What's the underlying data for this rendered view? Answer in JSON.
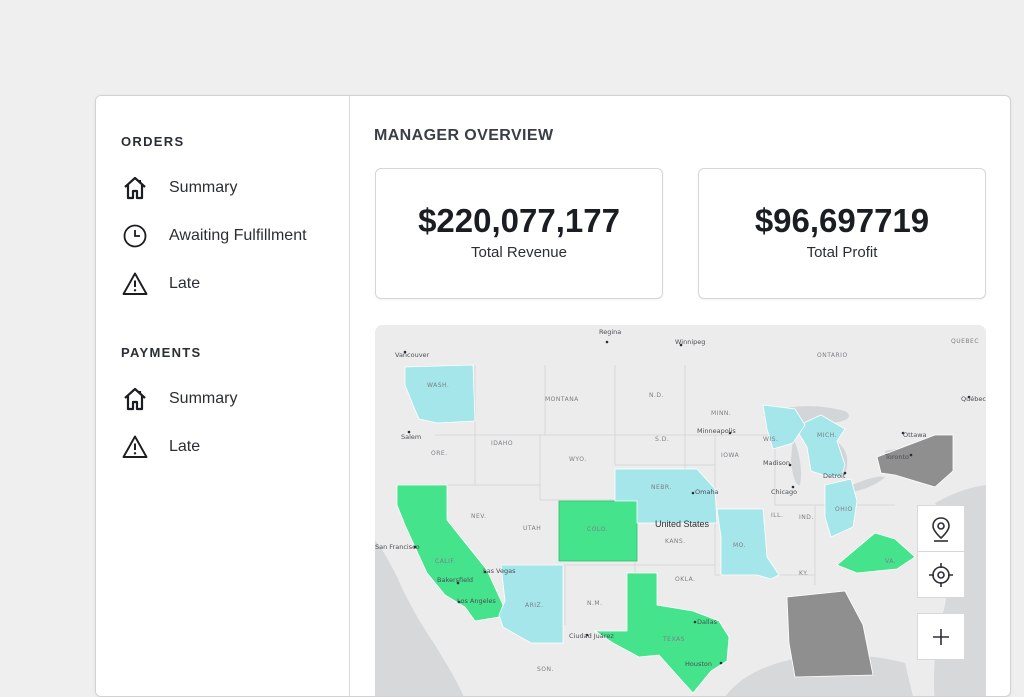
{
  "sidebar": {
    "orders_title": "ORDERS",
    "orders_items": [
      {
        "label": "Summary",
        "icon": "home-icon"
      },
      {
        "label": "Awaiting Fulfillment",
        "icon": "clock-icon"
      },
      {
        "label": "Late",
        "icon": "warning-icon"
      }
    ],
    "payments_title": "PAYMENTS",
    "payments_items": [
      {
        "label": "Summary",
        "icon": "home-icon"
      },
      {
        "label": "Late",
        "icon": "warning-icon"
      }
    ]
  },
  "main": {
    "title": "MANAGER OVERVIEW",
    "kpis": [
      {
        "value": "$220,077,177",
        "label": "Total Revenue"
      },
      {
        "value": "$96,697719",
        "label": "Total Profit"
      }
    ]
  },
  "map": {
    "country": "United States",
    "state_abbrevs": {
      "mont": "MONTANA",
      "nd": "N.D.",
      "minn": "MINN.",
      "ore": "ORE.",
      "idaho": "IDAHO",
      "wyo": "WYO.",
      "sd": "S.D.",
      "iowa": "IOWA",
      "wis": "WIS.",
      "mich": "MICH.",
      "nev": "NEV.",
      "utah": "UTAH",
      "colo": "COLO.",
      "nebr": "NEBR.",
      "kans": "KANS.",
      "mo": "MO.",
      "ill": "ILL.",
      "ind": "IND.",
      "ohio": "OHIO",
      "calif": "CALIF.",
      "ariz": "ARIZ.",
      "nm": "N.M.",
      "okla": "OKLA.",
      "tex": "TEXAS",
      "ky": "KY.",
      "va": "VA.",
      "wash": "WASH."
    },
    "cities": {
      "vancouver": "Vancouver",
      "salem": "Salem",
      "regina": "Regina",
      "winnipeg": "Winnipeg",
      "ontario": "ONTARIO",
      "quebec": "QUEBEC",
      "quebec_city": "Québec",
      "ottawa": "Ottawa",
      "toronto": "Toronto",
      "minneapolis": "Minneapolis",
      "madison": "Madison",
      "chicago": "Chicago",
      "detroit": "Detroit",
      "omaha": "Omaha",
      "san_francisco": "San Francisco",
      "bakersfield": "Bakersfield",
      "las_vegas": "Las Vegas",
      "los_angeles": "Los Angeles",
      "ciudad_juarez": "Ciudad Juárez",
      "dallas": "Dallas",
      "houston": "Houston",
      "son": "SON."
    },
    "legend_colors": {
      "high": "#45e38c",
      "medium": "#a4e6ea",
      "low": "#8f8f8f",
      "none": "#e6e6e6"
    }
  },
  "map_controls": {
    "location_pin": "location-pin-icon",
    "locate": "crosshair-icon",
    "zoom_in": "plus-icon"
  }
}
